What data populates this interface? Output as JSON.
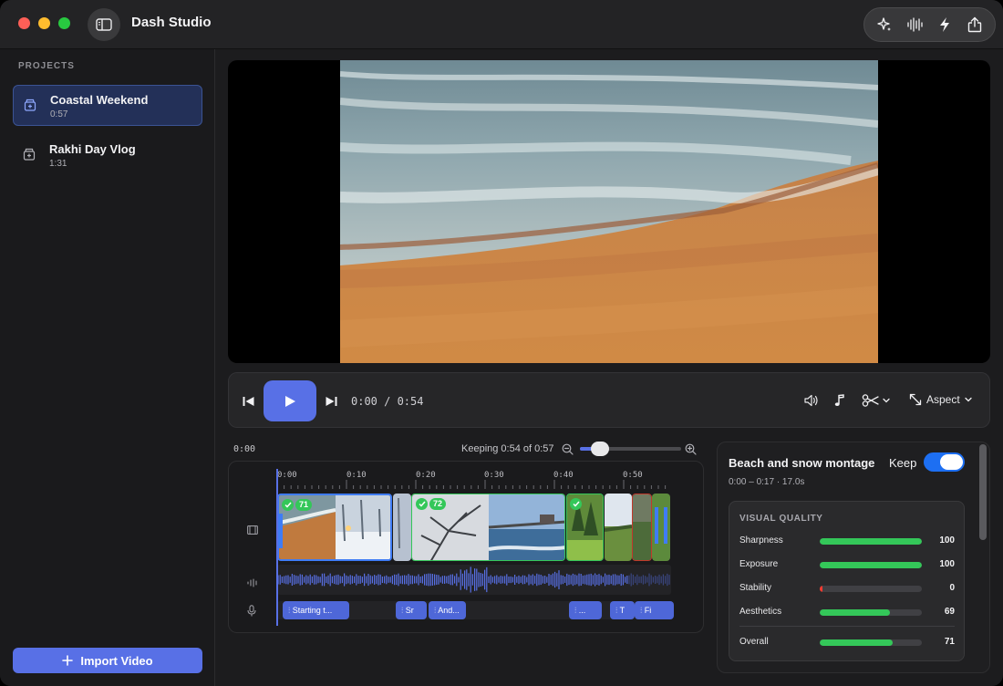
{
  "app": {
    "title": "Dash Studio"
  },
  "sidebar": {
    "heading": "PROJECTS",
    "projects": [
      {
        "name": "Coastal Weekend",
        "duration": "0:57",
        "active": true
      },
      {
        "name": "Rakhi Day Vlog",
        "duration": "1:31",
        "active": false
      }
    ],
    "import_label": "Import Video"
  },
  "toolbar": {
    "icons": [
      "sparkle-icon",
      "waveform-icon",
      "bolt-icon",
      "share-icon"
    ]
  },
  "player": {
    "timecode": "0:00 / 0:54",
    "aspect_label": "Aspect",
    "video_description_colors": {
      "sea": "#5f7f8c",
      "sand": "#c07a3e"
    }
  },
  "timeline": {
    "current_time": "0:00",
    "keeping": "Keeping 0:54 of 0:57",
    "zoom_level": 0.2,
    "ruler_labels": [
      "0:00",
      "0:10",
      "0:20",
      "0:30",
      "0:40",
      "0:50"
    ],
    "clips": [
      {
        "score": "71",
        "selected": true
      },
      {
        "score": "72",
        "selected": false
      },
      {
        "score": "",
        "selected": false
      },
      {
        "score": "",
        "selected": false
      }
    ],
    "captions": [
      "Starting t...",
      "Sr",
      "And...",
      "...",
      "T",
      "Fi"
    ]
  },
  "details": {
    "title": "Beach and snow montage",
    "keep_label": "Keep",
    "keep_on": true,
    "range": "0:00 – 0:17  ·  17.0s",
    "visual_quality_heading": "VISUAL QUALITY",
    "metrics": [
      {
        "label": "Sharpness",
        "value": "100",
        "fraction": 1.0,
        "color": "#34c759"
      },
      {
        "label": "Exposure",
        "value": "100",
        "fraction": 1.0,
        "color": "#34c759"
      },
      {
        "label": "Stability",
        "value": "0",
        "fraction": 0.0,
        "color": "#ff3b30"
      },
      {
        "label": "Aesthetics",
        "value": "69",
        "fraction": 0.69,
        "color": "#34c759"
      }
    ],
    "overall": {
      "label": "Overall",
      "value": "71",
      "fraction": 0.71,
      "color": "#34c759"
    }
  },
  "colors": {
    "accent": "#5870e6",
    "toggle_on": "#1d6ff2",
    "positive": "#34c759"
  }
}
